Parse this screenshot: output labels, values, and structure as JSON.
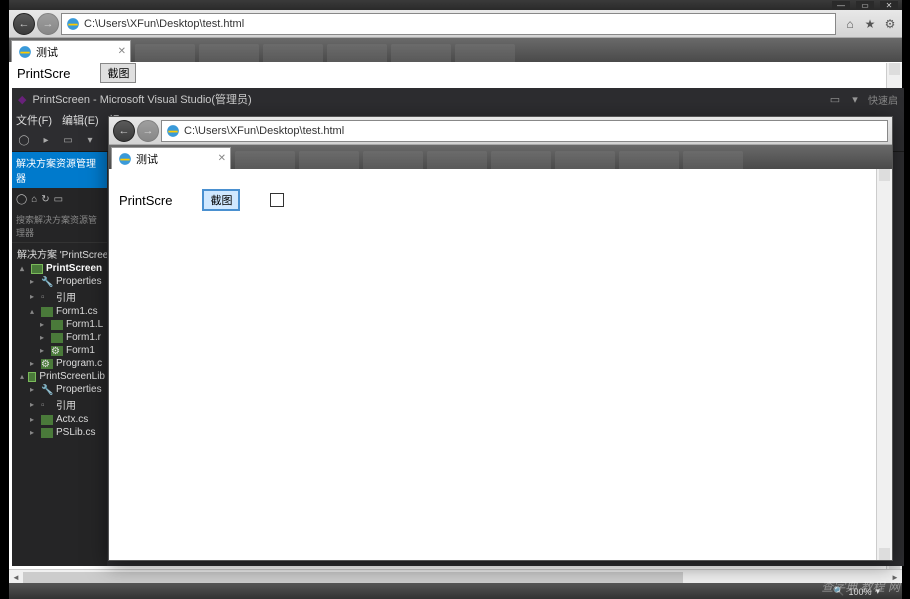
{
  "outer_ie": {
    "url": "C:\\Users\\XFun\\Desktop\\test.html",
    "tab_title": "测试",
    "page": {
      "label": "PrintScre",
      "button": "截图"
    }
  },
  "vs": {
    "title": "PrintScreen - Microsoft Visual Studio(管理员)",
    "quick_launch": "快速启",
    "menu": {
      "file": "文件(F)",
      "edit": "编辑(E)",
      "view": "视"
    },
    "solution_explorer": {
      "title": "解决方案资源管理器",
      "search_placeholder": "搜索解决方案资源管理器",
      "items": {
        "solution": "解决方案 'PrintScreen",
        "proj1": "PrintScreen",
        "properties1": "Properties",
        "references1": "引用",
        "form1cs": "Form1.cs",
        "form1d": "Form1.L",
        "form1r": "Form1.r",
        "form1": "Form1",
        "programcs": "Program.c",
        "proj2": "PrintScreenLib",
        "properties2": "Properties",
        "references2": "引用",
        "actxcs": "Actx.cs",
        "pslibcs": "PSLib.cs"
      }
    }
  },
  "inner_ie": {
    "url": "C:\\Users\\XFun\\Desktop\\test.html",
    "tab_title": "测试",
    "page": {
      "label": "PrintScre",
      "button": "截图"
    }
  },
  "watermark": "查字典 教程 网",
  "zoom": "100%"
}
